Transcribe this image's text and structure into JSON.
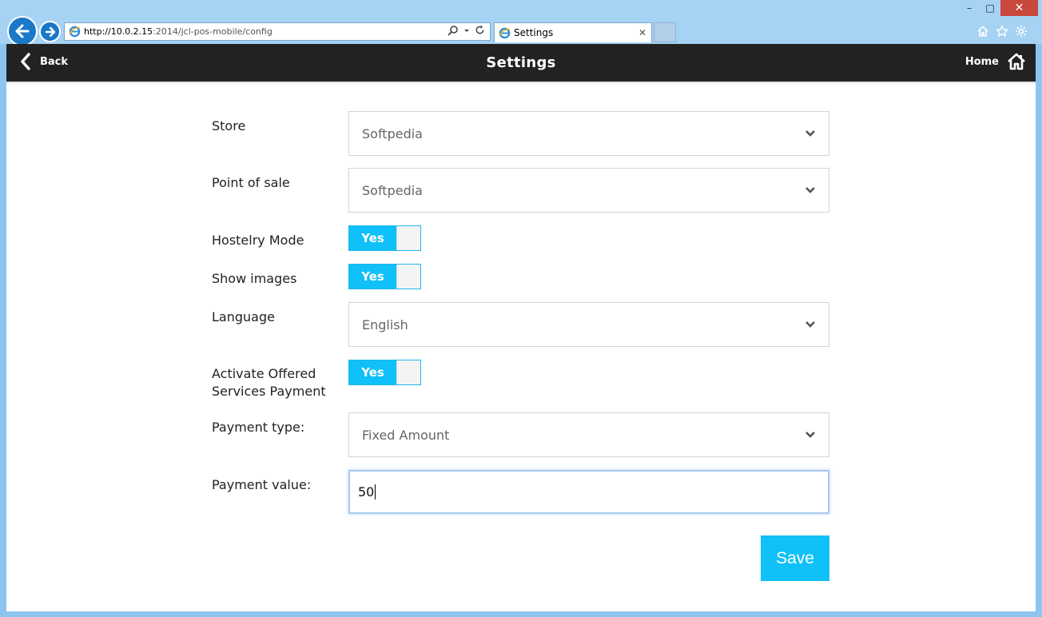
{
  "browser": {
    "url_host": "http://10.0.2.15",
    "url_path": ":2014/jcl-pos-mobile/config",
    "tab_title": "Settings",
    "window_controls": {
      "minimize": "–",
      "maximize": "□",
      "close": "✕"
    },
    "tab_close": "✕",
    "icons": [
      "home-icon",
      "star-icon",
      "gear-icon"
    ]
  },
  "header": {
    "back_label": "Back",
    "title": "Settings",
    "home_label": "Home"
  },
  "form": {
    "store": {
      "label": "Store",
      "value": "Softpedia"
    },
    "point_of_sale": {
      "label": "Point of sale",
      "value": "Softpedia"
    },
    "hostelry_mode": {
      "label": "Hostelry Mode",
      "value": "Yes"
    },
    "show_images": {
      "label": "Show images",
      "value": "Yes"
    },
    "language": {
      "label": "Language",
      "value": "English"
    },
    "activate_offered": {
      "label_line1": "Activate Offered",
      "label_line2": "Services Payment",
      "value": "Yes"
    },
    "payment_type": {
      "label": "Payment type:",
      "value": "Fixed Amount"
    },
    "payment_value": {
      "label": "Payment value:",
      "value": "50"
    },
    "save_label": "Save"
  },
  "colors": {
    "accent": "#10c0f8",
    "header_bg": "#222222",
    "chrome_bg": "#a6d2f3"
  }
}
